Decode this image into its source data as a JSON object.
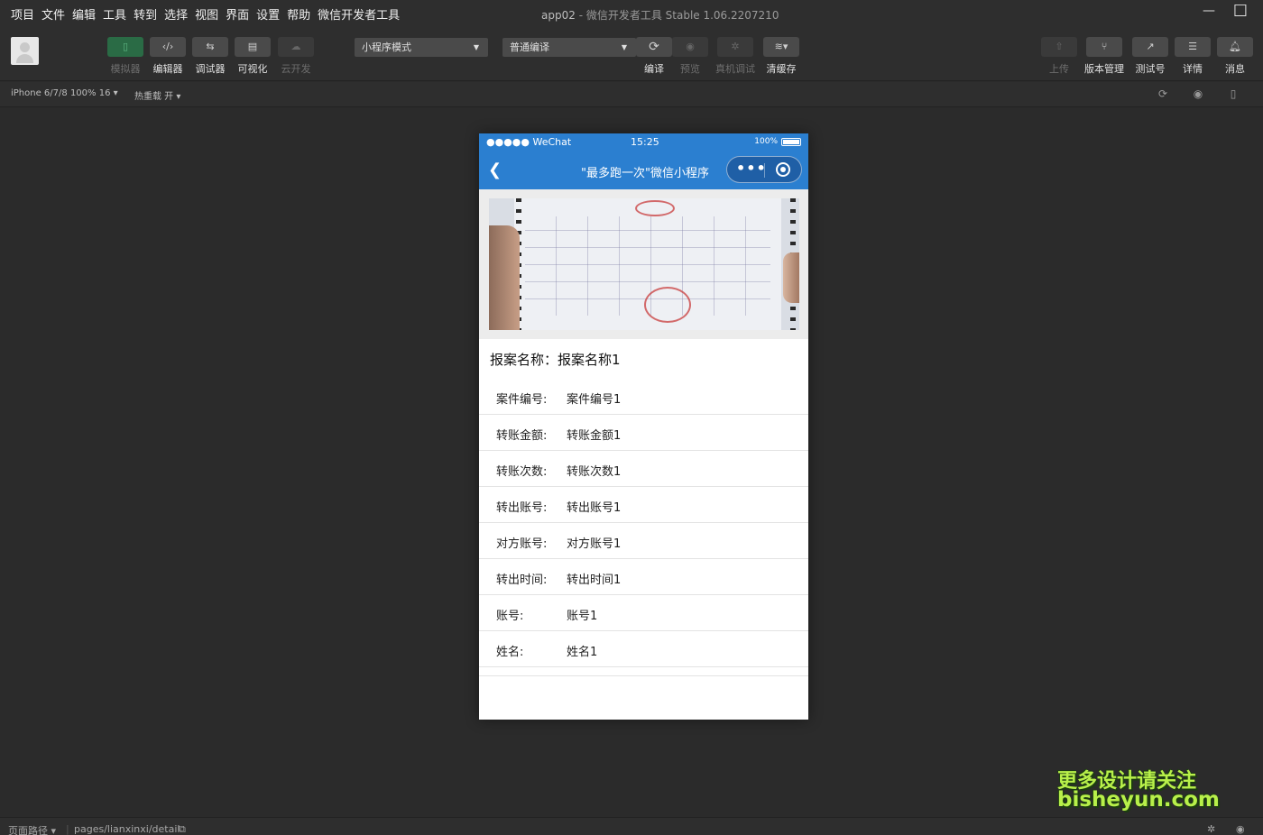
{
  "menu": [
    "项目",
    "文件",
    "编辑",
    "工具",
    "转到",
    "选择",
    "视图",
    "界面",
    "设置",
    "帮助",
    "微信开发者工具"
  ],
  "window": {
    "title": "app02",
    "subtitle": "- 微信开发者工具 Stable 1.06.2207210",
    "minimize": "—",
    "maximize": "☐"
  },
  "toolbar": {
    "simulator": "模拟器",
    "editor": "编辑器",
    "debugger": "调试器",
    "visual": "可视化",
    "cloud": "云开发",
    "mode": "小程序模式",
    "compile_mode": "普通编译",
    "compile": "编译",
    "preview": "预览",
    "real_debug": "真机调试",
    "clear_cache": "清缓存",
    "upload": "上传",
    "version": "版本管理",
    "test_account": "测试号",
    "details": "详情",
    "messages": "消息"
  },
  "subbar": {
    "device": "iPhone 6/7/8 100% 16 ▾",
    "hot_reload": "热重载 开 ▾"
  },
  "phone": {
    "status_left": "●●●●● WeChat",
    "time": "15:25",
    "battery": "100%",
    "nav_title": "\"最多跑一次\"微信小程序",
    "heading": "报案名称：报案名称1",
    "rows": [
      {
        "label": "案件编号:",
        "value": "案件编号1"
      },
      {
        "label": "转账金额:",
        "value": "转账金额1"
      },
      {
        "label": "转账次数:",
        "value": "转账次数1"
      },
      {
        "label": "转出账号:",
        "value": "转出账号1"
      },
      {
        "label": "对方账号:",
        "value": "对方账号1"
      },
      {
        "label": "转出时间:",
        "value": "转出时间1"
      },
      {
        "label": "账号:",
        "value": "账号1"
      },
      {
        "label": "姓名:",
        "value": "姓名1"
      }
    ]
  },
  "watermark": {
    "line1": "更多设计请关注",
    "line2": "bisheyun.com"
  },
  "bottombar": {
    "page_path_label": "页面路径 ▾",
    "page_path": "pages/lianxinxi/detail"
  }
}
